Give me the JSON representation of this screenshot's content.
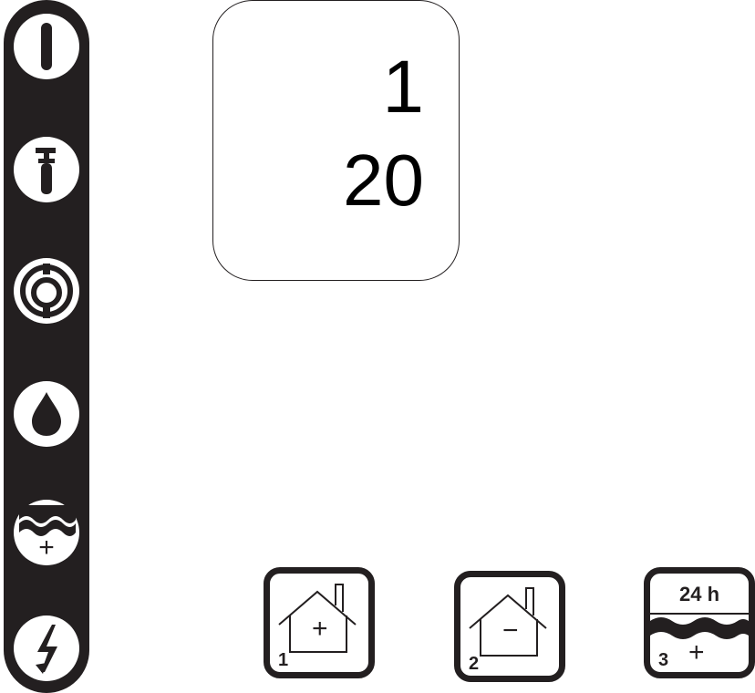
{
  "display": {
    "top_value": "1",
    "bottom_value": "20"
  },
  "sidebar": {
    "icons": [
      "power-icon",
      "wrench-icon",
      "burner-icon",
      "water-drop-icon",
      "water-fill-icon",
      "lightning-icon"
    ],
    "fill_plus": "+"
  },
  "buttons": {
    "heat_up": {
      "symbol": "+",
      "number": "1"
    },
    "heat_down": {
      "symbol": "−",
      "number": "2"
    },
    "fill_24h": {
      "label": "24 h",
      "symbol": "+",
      "number": "3"
    }
  },
  "colors": {
    "bar": "#231f20",
    "background": "#ffffff"
  }
}
